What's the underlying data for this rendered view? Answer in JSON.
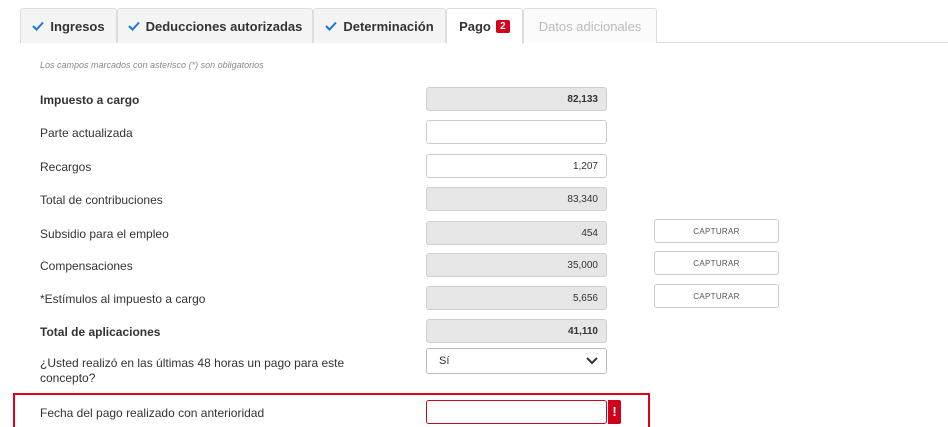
{
  "tabs": [
    {
      "label": "Ingresos",
      "checked": true
    },
    {
      "label": "Deducciones autorizadas",
      "checked": true
    },
    {
      "label": "Determinación",
      "checked": true
    },
    {
      "label": "Pago",
      "badge": "2",
      "active": true
    },
    {
      "label": "Datos adicionales",
      "disabled": true
    }
  ],
  "note": "Los campos marcados con asterisco (*) son obligatorios",
  "rows": [
    {
      "label": "Impuesto a cargo",
      "value": "82,133",
      "readonly": true
    },
    {
      "label": "Parte actualizada",
      "value": "",
      "readonly": false
    },
    {
      "label": "Recargos",
      "value": "1,207",
      "readonly": false
    },
    {
      "label": "Total de contribuciones",
      "value": "83,340",
      "readonly": true
    },
    {
      "label": "Subsidio para el empleo",
      "value": "454",
      "readonly": true,
      "button": "CAPTURAR"
    },
    {
      "label": "Compensaciones",
      "value": "35,000",
      "readonly": true,
      "button": "CAPTURAR"
    },
    {
      "label": "*Estímulos al impuesto a cargo",
      "value": "5,656",
      "readonly": true,
      "button": "CAPTURAR"
    },
    {
      "label": "Total de aplicaciones",
      "value": "41,110",
      "readonly": true
    }
  ],
  "question": {
    "label_line1": "¿Usted realizó en las últimas 48 horas un pago para este",
    "label_line2": "concepto?",
    "selected": "Sí"
  },
  "prior_payment": {
    "label": "Fecha del pago realizado con anterioridad",
    "value": "",
    "error_mark": "!"
  },
  "colors": {
    "error": "#d0021b",
    "check": "#1a73e8",
    "readonly_bg": "#e6e6e6"
  }
}
